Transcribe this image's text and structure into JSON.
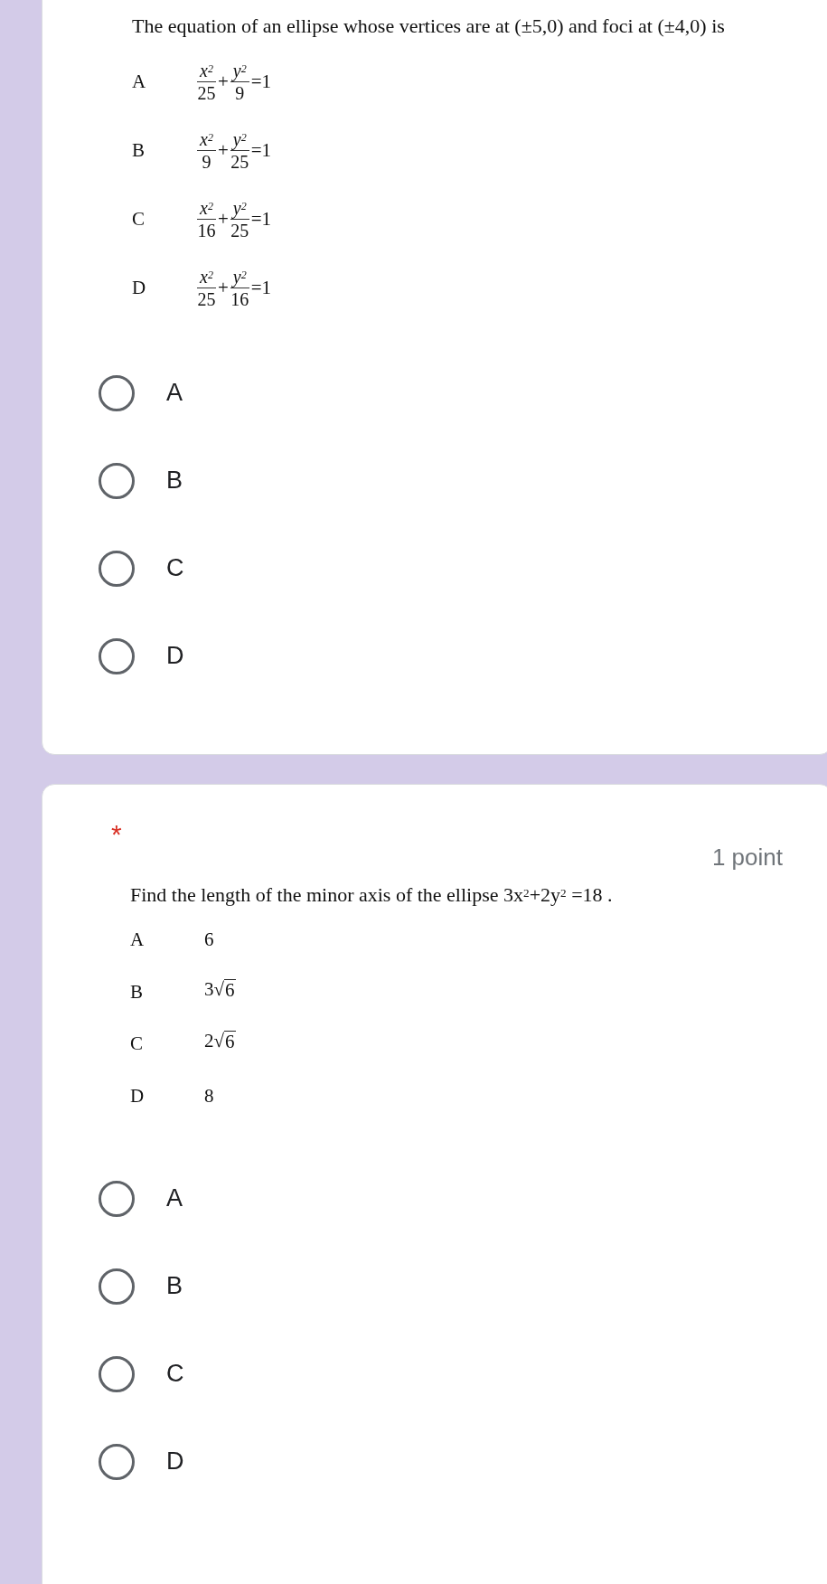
{
  "cards": [
    {
      "kind": "equations",
      "question": "The equation of an ellipse whose vertices are at (±5,0) and foci at (±4,0) is",
      "options": [
        {
          "letter": "A",
          "kind": "sum",
          "terms": [
            {
              "num": "x$^{2}$",
              "den": "25"
            },
            {
              "num": "y$^{2}$",
              "den": "9"
            }
          ],
          "plus": "+",
          "equals": "=1"
        },
        {
          "letter": "B",
          "kind": "sum",
          "terms": [
            {
              "num": "x$^{2}$",
              "den": "9"
            },
            {
              "num": "y$^{2}$",
              "den": "25"
            }
          ],
          "plus": "+",
          "equals": "=1"
        },
        {
          "letter": "C",
          "kind": "sum",
          "terms": [
            {
              "num": "x$^{2}$",
              "den": "16"
            },
            {
              "num": "y$^{2}$",
              "den": "25"
            }
          ],
          "plus": "+",
          "equals": "=1"
        },
        {
          "letter": "D",
          "kind": "sum",
          "terms": [
            {
              "num": "x$^{2}$",
              "den": "25"
            },
            {
              "num": "y$^{2}$",
              "den": "16"
            }
          ],
          "plus": "+",
          "equals": "=1"
        }
      ],
      "choices": [
        {
          "label": "A",
          "selected": false
        },
        {
          "label": "B",
          "selected": false
        },
        {
          "label": "C",
          "selected": false
        },
        {
          "label": "D",
          "selected": false
        }
      ]
    },
    {
      "kind": "question",
      "required_mark": "*",
      "points": "1 point",
      "question": "Find the length of the minor axis of the ellipse 3x$^{2}$+2y$^{2}$ =18 .",
      "options": [
        {
          "letter": "A",
          "kind": "plain",
          "value": "6"
        },
        {
          "letter": "B",
          "kind": "radical",
          "coef": "3",
          "root": "√",
          "radicand": "6"
        },
        {
          "letter": "C",
          "kind": "radical",
          "coef": "2",
          "root": "√",
          "radicand": "6"
        },
        {
          "letter": "D",
          "kind": "plain",
          "value": "8"
        }
      ],
      "choices": [
        {
          "label": "A",
          "selected": false
        },
        {
          "label": "B",
          "selected": false
        },
        {
          "label": "C",
          "selected": false
        },
        {
          "label": "D",
          "selected": false
        }
      ]
    }
  ]
}
